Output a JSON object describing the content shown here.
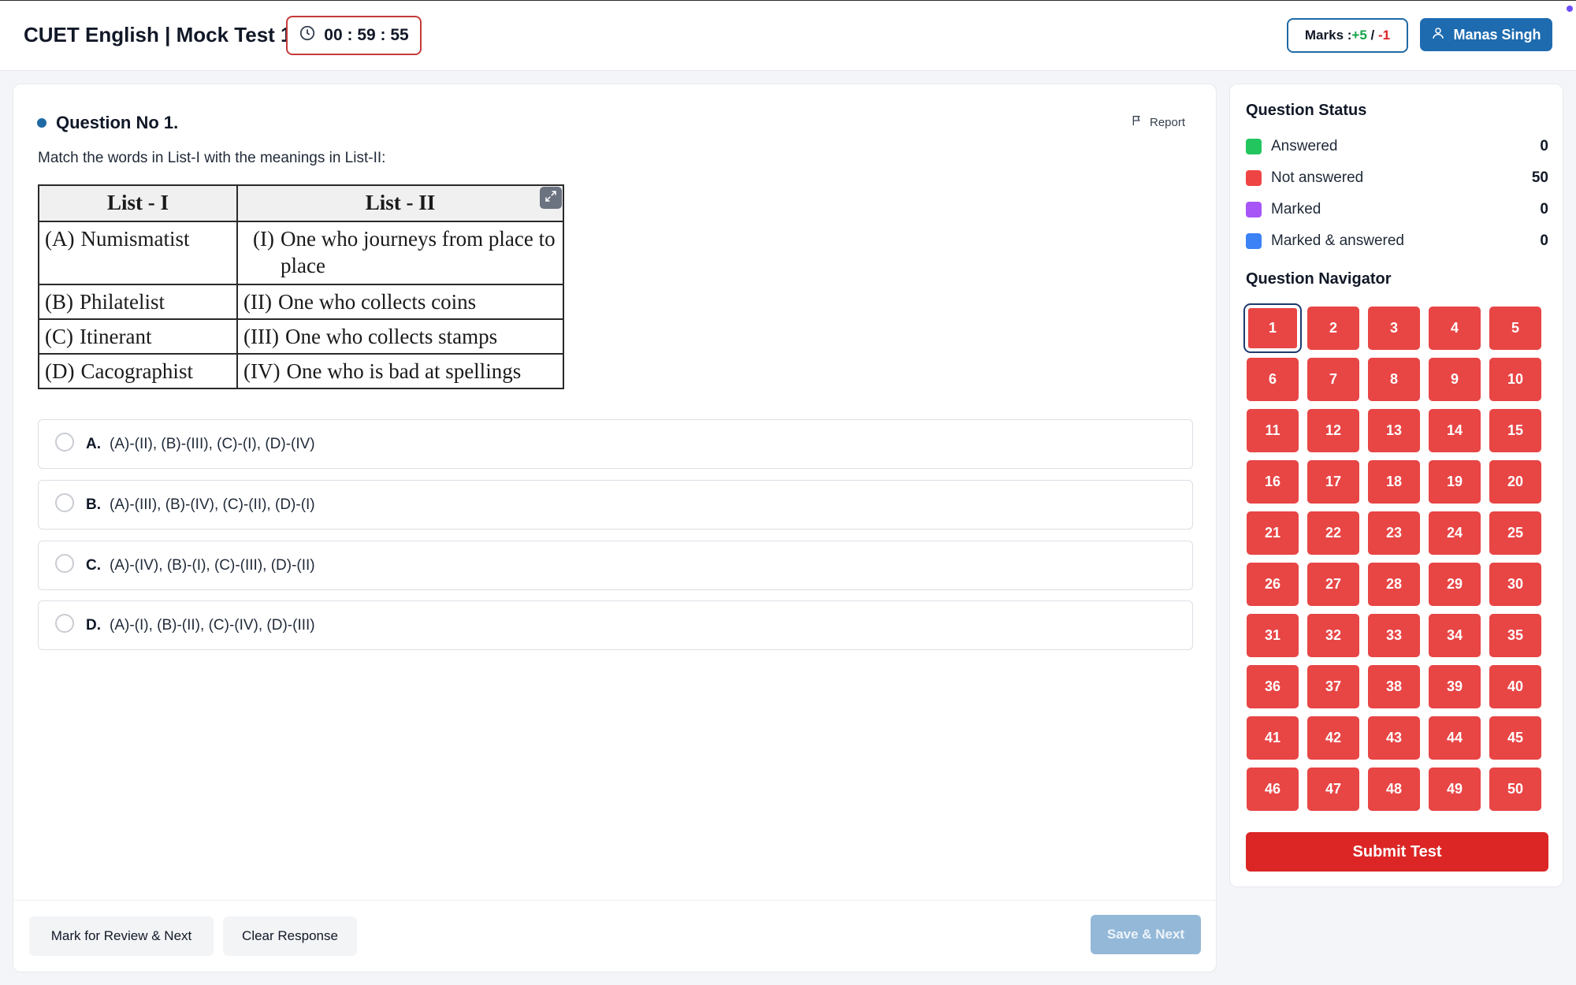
{
  "header": {
    "app_title": "CUET English | Mock Test 1",
    "timer": "00 : 59 : 55",
    "marks_prefix": "Marks : ",
    "marks_positive": "+5",
    "marks_sep": " / ",
    "marks_negative": "-1",
    "user_name": "Manas Singh"
  },
  "question": {
    "heading": "Question No 1.",
    "report_label": "Report",
    "text": "Match the words in List-I with the meanings in List-II:",
    "table": {
      "headers": [
        "List - I",
        "List - II"
      ],
      "rows": [
        {
          "l1_label": "(A)",
          "l1_text": "Numismatist",
          "l2_label": "(I)",
          "l2_text": "One who journeys from place to place"
        },
        {
          "l1_label": "(B)",
          "l1_text": "Philatelist",
          "l2_label": "(II)",
          "l2_text": "One who collects coins"
        },
        {
          "l1_label": "(C)",
          "l1_text": "Itinerant",
          "l2_label": "(III)",
          "l2_text": "One who collects stamps"
        },
        {
          "l1_label": "(D)",
          "l1_text": "Cacographist",
          "l2_label": "(IV)",
          "l2_text": "One who is bad at spellings"
        }
      ]
    },
    "options": [
      {
        "letter": "A.",
        "text": "(A)-(II), (B)-(III), (C)-(I), (D)-(IV)"
      },
      {
        "letter": "B.",
        "text": "(A)-(III), (B)-(IV), (C)-(II), (D)-(I)"
      },
      {
        "letter": "C.",
        "text": "(A)-(IV), (B)-(I), (C)-(III), (D)-(II)"
      },
      {
        "letter": "D.",
        "text": "(A)-(I), (B)-(II), (C)-(IV), (D)-(III)"
      }
    ]
  },
  "footer": {
    "review_label": "Mark for Review & Next",
    "clear_label": "Clear Response",
    "save_label": "Save & Next"
  },
  "panel": {
    "status_title": "Question Status",
    "statuses": [
      {
        "label": "Answered",
        "count": "0",
        "color": "#22c55e"
      },
      {
        "label": "Not answered",
        "count": "50",
        "color": "#ef4444"
      },
      {
        "label": "Marked",
        "count": "0",
        "color": "#a855f7"
      },
      {
        "label": "Marked & answered",
        "count": "0",
        "color": "#3b82f6"
      }
    ],
    "navigator_title": "Question Navigator",
    "questions": [
      "1",
      "2",
      "3",
      "4",
      "5",
      "6",
      "7",
      "8",
      "9",
      "10",
      "11",
      "12",
      "13",
      "14",
      "15",
      "16",
      "17",
      "18",
      "19",
      "20",
      "21",
      "22",
      "23",
      "24",
      "25",
      "26",
      "27",
      "28",
      "29",
      "30",
      "31",
      "32",
      "33",
      "34",
      "35",
      "36",
      "37",
      "38",
      "39",
      "40",
      "41",
      "42",
      "43",
      "44",
      "45",
      "46",
      "47",
      "48",
      "49",
      "50"
    ],
    "current_question": "1",
    "submit_label": "Submit Test"
  },
  "icons": {
    "timer": "clock-icon",
    "user": "user-icon",
    "report": "flag-icon",
    "expand": "expand-icon"
  }
}
